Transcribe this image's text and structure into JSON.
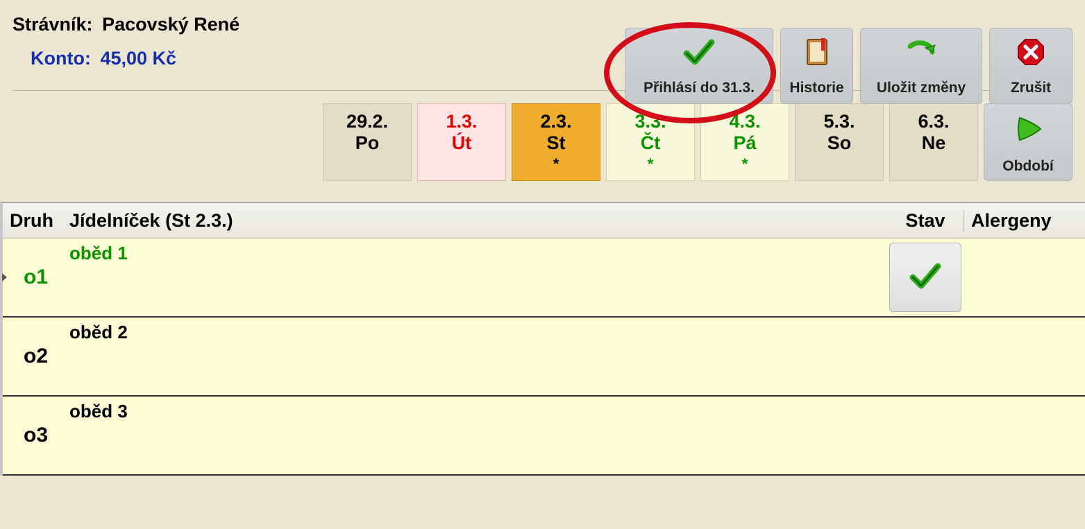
{
  "info": {
    "stravnik_label": "Strávník:",
    "stravnik_value": "Pacovský René",
    "konto_label": "Konto:",
    "konto_value": "45,00 Kč"
  },
  "toolbar": {
    "register_until": "Přihlásí do 31.3.",
    "history": "Historie",
    "save": "Uložit změny",
    "cancel": "Zrušit"
  },
  "days": [
    {
      "date": "29.2.",
      "dow": "Po",
      "star": "",
      "klass": ""
    },
    {
      "date": "1.3.",
      "dow": "Út",
      "star": "",
      "klass": "red"
    },
    {
      "date": "2.3.",
      "dow": "St",
      "star": "*",
      "klass": "selected"
    },
    {
      "date": "3.3.",
      "dow": "Čt",
      "star": "*",
      "klass": "green"
    },
    {
      "date": "4.3.",
      "dow": "Pá",
      "star": "*",
      "klass": "green"
    },
    {
      "date": "5.3.",
      "dow": "So",
      "star": "",
      "klass": ""
    },
    {
      "date": "6.3.",
      "dow": "Ne",
      "star": "",
      "klass": ""
    }
  ],
  "period_label": "Období",
  "table": {
    "headers": {
      "druh": "Druh",
      "jidel": "Jídelníček  (St 2.3.)",
      "stav": "Stav",
      "aler": "Alergeny"
    },
    "rows": [
      {
        "kod": "o1",
        "name": "oběd 1",
        "selected": true,
        "has_stav": true
      },
      {
        "kod": "o2",
        "name": "oběd 2",
        "selected": false,
        "has_stav": false
      },
      {
        "kod": "o3",
        "name": "oběd 3",
        "selected": false,
        "has_stav": false
      }
    ]
  }
}
